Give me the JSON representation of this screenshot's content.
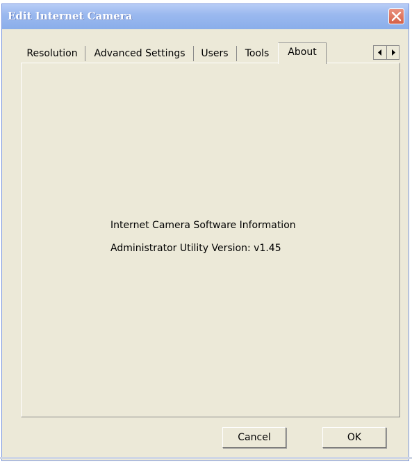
{
  "window": {
    "title": "Edit Internet Camera"
  },
  "tabs": [
    {
      "label": "Resolution",
      "active": false
    },
    {
      "label": "Advanced Settings",
      "active": false
    },
    {
      "label": "Users",
      "active": false
    },
    {
      "label": "Tools",
      "active": false
    },
    {
      "label": "About",
      "active": true
    }
  ],
  "about": {
    "heading": "Internet Camera Software Information",
    "version_line": "Administrator Utility Version: v1.45"
  },
  "buttons": {
    "cancel": "Cancel",
    "ok": "OK"
  },
  "icons": {
    "close": "close-icon",
    "tab_left": "arrow-left-icon",
    "tab_right": "arrow-right-icon"
  },
  "colors": {
    "dialog_bg": "#ece9d8",
    "titlebar": "#9bb9ef",
    "close_button": "#d56046"
  }
}
